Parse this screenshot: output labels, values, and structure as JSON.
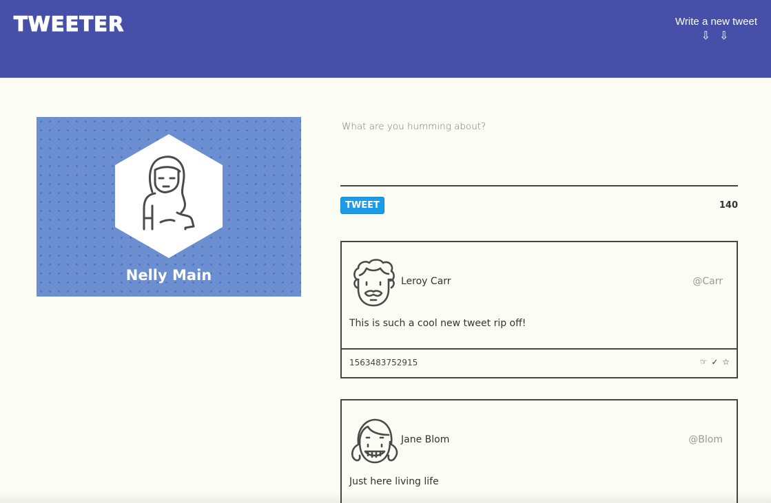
{
  "nav": {
    "brand": "TWEETER",
    "compose_label": "Write a new tweet",
    "compose_arrows": "⇩ ⇩"
  },
  "profile": {
    "name": "Nelly Main"
  },
  "composer": {
    "placeholder": "What are you humming about?",
    "button_label": "TWEET",
    "counter": "140"
  },
  "tweets": [
    {
      "name": "Leroy Carr",
      "handle": "@Carr",
      "text": "This is such a cool new tweet rip off!",
      "timestamp": "1563483752915",
      "actions": [
        "☞",
        "✓",
        "☆"
      ]
    },
    {
      "name": "Jane Blom",
      "handle": "@Blom",
      "text": "Just here living life"
    }
  ],
  "colors": {
    "nav_bg": "#4650a8",
    "profile_bg": "#6b8fd1",
    "tweet_button": "#1b9be8",
    "page_bg": "#fbfcf4"
  }
}
